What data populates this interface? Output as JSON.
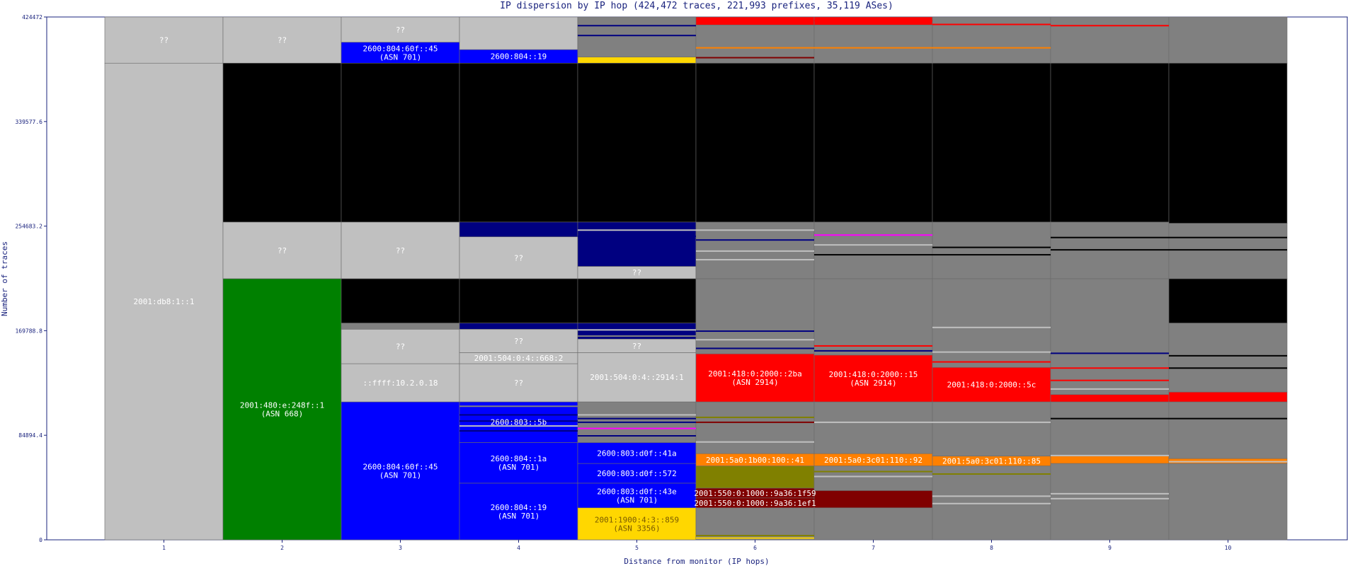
{
  "chart_data": {
    "type": "stacked_columns",
    "title": "IP dispersion by IP hop (424,472 traces, 221,993 prefixes, 35,119 ASes)",
    "xlabel": "Distance from monitor (IP hops)",
    "ylabel": "Number of traces",
    "x_ticks": [
      "1",
      "2",
      "3",
      "4",
      "5",
      "6",
      "7",
      "8",
      "9",
      "10"
    ],
    "y_ticks": [
      "0",
      "84894.4",
      "169788.8",
      "254683.2",
      "339577.6",
      "424472"
    ],
    "ylim": [
      0,
      424472
    ],
    "colors": {
      "unknown": "#c0c0c0",
      "dark_gray": "#808080",
      "black": "#000000",
      "blue": "#0000ff",
      "navy": "#000080",
      "green": "#008000",
      "red": "#ff0000",
      "orange": "#ff8000",
      "gold": "#ffd700",
      "olive": "#808000",
      "maroon": "#800000",
      "magenta": "#ff00ff"
    },
    "columns": [
      {
        "hop": 1,
        "blocks": [
          {
            "from": 0,
            "to": 387000,
            "color": "#c0c0c0",
            "label": "2001:db8:1::1"
          },
          {
            "from": 387000,
            "to": 424472,
            "color": "#c0c0c0",
            "label": "??"
          }
        ]
      },
      {
        "hop": 2,
        "blocks": [
          {
            "from": 0,
            "to": 212000,
            "color": "#008000",
            "label": "2001:480:e:248f::1",
            "sublabel": "(ASN 668)"
          },
          {
            "from": 212000,
            "to": 258000,
            "color": "#c0c0c0",
            "label": "??"
          },
          {
            "from": 258000,
            "to": 387000,
            "color": "#000000"
          },
          {
            "from": 387000,
            "to": 424472,
            "color": "#c0c0c0",
            "label": "??"
          }
        ]
      },
      {
        "hop": 3,
        "blocks": [
          {
            "from": 0,
            "to": 112000,
            "color": "#0000ff",
            "label": "2600:804:60f::45",
            "sublabel": "(ASN 701)"
          },
          {
            "from": 112000,
            "to": 143000,
            "color": "#c0c0c0",
            "label": "::ffff:10.2.0.18"
          },
          {
            "from": 143000,
            "to": 171000,
            "color": "#c0c0c0",
            "label": "??"
          },
          {
            "from": 171000,
            "to": 176000,
            "color": "#808080"
          },
          {
            "from": 176000,
            "to": 212000,
            "color": "#000000"
          },
          {
            "from": 212000,
            "to": 258000,
            "color": "#c0c0c0",
            "label": "??"
          },
          {
            "from": 258000,
            "to": 387000,
            "color": "#000000"
          },
          {
            "from": 387000,
            "to": 404000,
            "color": "#0000ff",
            "label": "2600:804:60f::45",
            "sublabel": "(ASN 701)"
          },
          {
            "from": 404000,
            "to": 424472,
            "color": "#c0c0c0",
            "label": "??"
          }
        ]
      },
      {
        "hop": 4,
        "blocks": [
          {
            "from": 0,
            "to": 46000,
            "color": "#0000ff",
            "label": "2600:804::19",
            "sublabel": "(ASN 701)"
          },
          {
            "from": 46000,
            "to": 79000,
            "color": "#0000ff",
            "label": "2600:804::1a",
            "sublabel": "(ASN 701)"
          },
          {
            "from": 79000,
            "to": 112000,
            "color": "#0000ff",
            "label": "2600:803::5b"
          },
          {
            "from": 112000,
            "to": 143000,
            "color": "#c0c0c0",
            "label": "??"
          },
          {
            "from": 143000,
            "to": 152000,
            "color": "#c0c0c0",
            "label": "2001:504:0:4::668:2"
          },
          {
            "from": 152000,
            "to": 171000,
            "color": "#c0c0c0",
            "label": "??"
          },
          {
            "from": 171000,
            "to": 176000,
            "color": "#000080"
          },
          {
            "from": 176000,
            "to": 212000,
            "color": "#000000"
          },
          {
            "from": 212000,
            "to": 246000,
            "color": "#c0c0c0",
            "label": "??"
          },
          {
            "from": 246000,
            "to": 258000,
            "color": "#000080"
          },
          {
            "from": 258000,
            "to": 387000,
            "color": "#000000"
          },
          {
            "from": 387000,
            "to": 398000,
            "color": "#0000ff",
            "label": "2600:804::19"
          },
          {
            "from": 398000,
            "to": 424472,
            "color": "#c0c0c0"
          }
        ]
      },
      {
        "hop": 5,
        "blocks": [
          {
            "from": 0,
            "to": 26000,
            "color": "#ffd700",
            "label": "2001:1900:4:3::859",
            "sublabel": "(ASN 3356)"
          },
          {
            "from": 26000,
            "to": 46000,
            "color": "#0000ff",
            "label": "2600:803:d0f::43e",
            "sublabel": "(ASN 701)"
          },
          {
            "from": 46000,
            "to": 62000,
            "color": "#0000ff",
            "label": "2600:803:d0f::572"
          },
          {
            "from": 62000,
            "to": 79000,
            "color": "#0000ff",
            "label": "2600:803:d0f::41a"
          },
          {
            "from": 79000,
            "to": 112000,
            "color": "#808080"
          },
          {
            "from": 112000,
            "to": 152000,
            "color": "#c0c0c0",
            "label": "2001:504:0:4::2914:1"
          },
          {
            "from": 152000,
            "to": 163000,
            "color": "#c0c0c0",
            "label": "??"
          },
          {
            "from": 163000,
            "to": 176000,
            "color": "#000080"
          },
          {
            "from": 176000,
            "to": 212000,
            "color": "#000000"
          },
          {
            "from": 212000,
            "to": 222000,
            "color": "#c0c0c0",
            "label": "??"
          },
          {
            "from": 222000,
            "to": 258000,
            "color": "#000080"
          },
          {
            "from": 258000,
            "to": 387000,
            "color": "#000000"
          },
          {
            "from": 387000,
            "to": 392000,
            "color": "#ffd700"
          },
          {
            "from": 392000,
            "to": 424472,
            "color": "#808080"
          }
        ]
      },
      {
        "hop": 6,
        "blocks": [
          {
            "from": 0,
            "to": 26000,
            "color": "#808080"
          },
          {
            "from": 26000,
            "to": 34000,
            "color": "#800000",
            "label": "2001:550:0:1000::9a36:1ef1"
          },
          {
            "from": 34000,
            "to": 42000,
            "color": "#800000",
            "label": "2001:550:0:1000::9a36:1f59"
          },
          {
            "from": 42000,
            "to": 60000,
            "color": "#808000"
          },
          {
            "from": 60000,
            "to": 70000,
            "color": "#ff8000",
            "label": "2001:5a0:1b00:100::41"
          },
          {
            "from": 70000,
            "to": 112000,
            "color": "#808080"
          },
          {
            "from": 112000,
            "to": 151000,
            "color": "#ff0000",
            "label": "2001:418:0:2000::2ba",
            "sublabel": "(ASN 2914)"
          },
          {
            "from": 151000,
            "to": 212000,
            "color": "#808080"
          },
          {
            "from": 212000,
            "to": 258000,
            "color": "#808080"
          },
          {
            "from": 258000,
            "to": 387000,
            "color": "#000000"
          },
          {
            "from": 387000,
            "to": 418000,
            "color": "#808080"
          },
          {
            "from": 418000,
            "to": 424472,
            "color": "#ff0000"
          }
        ]
      },
      {
        "hop": 7,
        "blocks": [
          {
            "from": 0,
            "to": 26000,
            "color": "#808080"
          },
          {
            "from": 26000,
            "to": 40000,
            "color": "#800000"
          },
          {
            "from": 40000,
            "to": 60000,
            "color": "#808080"
          },
          {
            "from": 60000,
            "to": 70000,
            "color": "#ff8000",
            "label": "2001:5a0:3c01:110::92"
          },
          {
            "from": 70000,
            "to": 112000,
            "color": "#808080"
          },
          {
            "from": 112000,
            "to": 150000,
            "color": "#ff0000",
            "label": "2001:418:0:2000::15",
            "sublabel": "(ASN 2914)"
          },
          {
            "from": 150000,
            "to": 212000,
            "color": "#808080"
          },
          {
            "from": 212000,
            "to": 258000,
            "color": "#808080"
          },
          {
            "from": 258000,
            "to": 387000,
            "color": "#000000"
          },
          {
            "from": 387000,
            "to": 418000,
            "color": "#808080"
          },
          {
            "from": 418000,
            "to": 424472,
            "color": "#ff0000"
          }
        ]
      },
      {
        "hop": 8,
        "blocks": [
          {
            "from": 0,
            "to": 60000,
            "color": "#808080"
          },
          {
            "from": 60000,
            "to": 68000,
            "color": "#ff8000",
            "label": "2001:5a0:3c01:110::85"
          },
          {
            "from": 68000,
            "to": 112000,
            "color": "#808080"
          },
          {
            "from": 112000,
            "to": 140000,
            "color": "#ff0000",
            "label": "2001:418:0:2000::5c"
          },
          {
            "from": 140000,
            "to": 212000,
            "color": "#808080"
          },
          {
            "from": 212000,
            "to": 258000,
            "color": "#808080"
          },
          {
            "from": 258000,
            "to": 387000,
            "color": "#000000"
          },
          {
            "from": 387000,
            "to": 424472,
            "color": "#808080"
          }
        ]
      },
      {
        "hop": 9,
        "blocks": [
          {
            "from": 0,
            "to": 62000,
            "color": "#808080"
          },
          {
            "from": 62000,
            "to": 68000,
            "color": "#ff8000"
          },
          {
            "from": 68000,
            "to": 112000,
            "color": "#808080"
          },
          {
            "from": 112000,
            "to": 118000,
            "color": "#ff0000"
          },
          {
            "from": 118000,
            "to": 212000,
            "color": "#808080"
          },
          {
            "from": 212000,
            "to": 258000,
            "color": "#808080"
          },
          {
            "from": 258000,
            "to": 387000,
            "color": "#000000"
          },
          {
            "from": 387000,
            "to": 424472,
            "color": "#808080"
          }
        ]
      },
      {
        "hop": 10,
        "blocks": [
          {
            "from": 0,
            "to": 62000,
            "color": "#808080"
          },
          {
            "from": 62000,
            "to": 66000,
            "color": "#ff8000"
          },
          {
            "from": 66000,
            "to": 112000,
            "color": "#808080"
          },
          {
            "from": 112000,
            "to": 120000,
            "color": "#ff0000"
          },
          {
            "from": 120000,
            "to": 176000,
            "color": "#808080"
          },
          {
            "from": 176000,
            "to": 212000,
            "color": "#000000"
          },
          {
            "from": 212000,
            "to": 257000,
            "color": "#808080"
          },
          {
            "from": 257000,
            "to": 387000,
            "color": "#000000"
          },
          {
            "from": 387000,
            "to": 424472,
            "color": "#808080"
          }
        ]
      }
    ],
    "stripes": [
      {
        "hop": 4,
        "y": 102000,
        "color": "#000080"
      },
      {
        "hop": 4,
        "y": 97000,
        "color": "#000080"
      },
      {
        "hop": 4,
        "y": 93000,
        "color": "#c0c0c0"
      },
      {
        "hop": 4,
        "y": 89000,
        "color": "#000080"
      },
      {
        "hop": 4,
        "y": 109000,
        "color": "#808080"
      },
      {
        "hop": 5,
        "y": 102000,
        "color": "#c0c0c0"
      },
      {
        "hop": 5,
        "y": 99000,
        "color": "#000080"
      },
      {
        "hop": 5,
        "y": 91000,
        "color": "#ff00ff"
      },
      {
        "hop": 5,
        "y": 96000,
        "color": "#000080"
      },
      {
        "hop": 5,
        "y": 85000,
        "color": "#000080"
      },
      {
        "hop": 5,
        "y": 166000,
        "color": "#808080"
      },
      {
        "hop": 5,
        "y": 171000,
        "color": "#c0c0c0"
      },
      {
        "hop": 5,
        "y": 252000,
        "color": "#c0c0c0"
      },
      {
        "hop": 5,
        "y": 247000,
        "color": "#000080"
      },
      {
        "hop": 5,
        "y": 418000,
        "color": "#000080"
      },
      {
        "hop": 5,
        "y": 410000,
        "color": "#000080"
      },
      {
        "hop": 6,
        "y": 100000,
        "color": "#808000"
      },
      {
        "hop": 6,
        "y": 96000,
        "color": "#800000"
      },
      {
        "hop": 6,
        "y": 80000,
        "color": "#c0c0c0"
      },
      {
        "hop": 6,
        "y": 156000,
        "color": "#000080"
      },
      {
        "hop": 6,
        "y": 163000,
        "color": "#c0c0c0"
      },
      {
        "hop": 6,
        "y": 170000,
        "color": "#000080"
      },
      {
        "hop": 6,
        "y": 235000,
        "color": "#c0c0c0"
      },
      {
        "hop": 6,
        "y": 228000,
        "color": "#c0c0c0"
      },
      {
        "hop": 6,
        "y": 244000,
        "color": "#000080"
      },
      {
        "hop": 6,
        "y": 252000,
        "color": "#c0c0c0"
      },
      {
        "hop": 6,
        "y": 400000,
        "color": "#ff8000"
      },
      {
        "hop": 6,
        "y": 392000,
        "color": "#800000"
      },
      {
        "hop": 6,
        "y": 4000,
        "color": "#808000"
      },
      {
        "hop": 6,
        "y": 2000,
        "color": "#ffd700"
      },
      {
        "hop": 7,
        "y": 96000,
        "color": "#c0c0c0"
      },
      {
        "hop": 7,
        "y": 52000,
        "color": "#c0c0c0"
      },
      {
        "hop": 7,
        "y": 56000,
        "color": "#808000"
      },
      {
        "hop": 7,
        "y": 154000,
        "color": "#000080"
      },
      {
        "hop": 7,
        "y": 158000,
        "color": "#ff0000"
      },
      {
        "hop": 7,
        "y": 240000,
        "color": "#c0c0c0"
      },
      {
        "hop": 7,
        "y": 232000,
        "color": "#000000"
      },
      {
        "hop": 7,
        "y": 248000,
        "color": "#ff00ff"
      },
      {
        "hop": 7,
        "y": 422000,
        "color": "#ff0000"
      },
      {
        "hop": 7,
        "y": 400000,
        "color": "#ff8000"
      },
      {
        "hop": 8,
        "y": 96000,
        "color": "#c0c0c0"
      },
      {
        "hop": 8,
        "y": 54000,
        "color": "#808000"
      },
      {
        "hop": 8,
        "y": 30000,
        "color": "#c0c0c0"
      },
      {
        "hop": 8,
        "y": 36000,
        "color": "#c0c0c0"
      },
      {
        "hop": 8,
        "y": 153000,
        "color": "#c0c0c0"
      },
      {
        "hop": 8,
        "y": 145000,
        "color": "#ff0000"
      },
      {
        "hop": 8,
        "y": 232000,
        "color": "#000000"
      },
      {
        "hop": 8,
        "y": 238000,
        "color": "#000000"
      },
      {
        "hop": 8,
        "y": 173000,
        "color": "#c0c0c0"
      },
      {
        "hop": 8,
        "y": 400000,
        "color": "#ff8000"
      },
      {
        "hop": 8,
        "y": 419000,
        "color": "#ff0000"
      },
      {
        "hop": 9,
        "y": 99000,
        "color": "#000000"
      },
      {
        "hop": 9,
        "y": 152000,
        "color": "#000080"
      },
      {
        "hop": 9,
        "y": 140000,
        "color": "#ff0000"
      },
      {
        "hop": 9,
        "y": 130000,
        "color": "#ff0000"
      },
      {
        "hop": 9,
        "y": 123000,
        "color": "#c0c0c0"
      },
      {
        "hop": 9,
        "y": 34000,
        "color": "#c0c0c0"
      },
      {
        "hop": 9,
        "y": 38000,
        "color": "#c0c0c0"
      },
      {
        "hop": 9,
        "y": 236000,
        "color": "#000000"
      },
      {
        "hop": 9,
        "y": 246000,
        "color": "#000000"
      },
      {
        "hop": 9,
        "y": 69000,
        "color": "#c0c0c0"
      },
      {
        "hop": 9,
        "y": 418000,
        "color": "#ff0000"
      },
      {
        "hop": 10,
        "y": 99000,
        "color": "#000000"
      },
      {
        "hop": 10,
        "y": 150000,
        "color": "#000000"
      },
      {
        "hop": 10,
        "y": 140000,
        "color": "#000000"
      },
      {
        "hop": 10,
        "y": 236000,
        "color": "#000000"
      },
      {
        "hop": 10,
        "y": 246000,
        "color": "#000000"
      },
      {
        "hop": 10,
        "y": 64000,
        "color": "#c0c0c0"
      }
    ]
  }
}
